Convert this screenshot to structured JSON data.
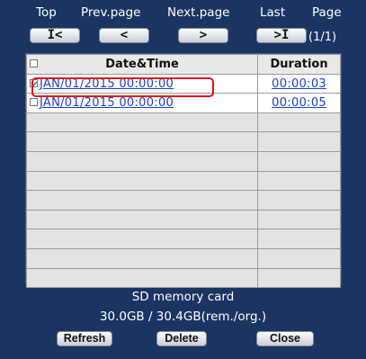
{
  "nav": {
    "top_label": "Top",
    "prev_label": "Prev.page",
    "next_label": "Next.page",
    "last_label": "Last",
    "page_label": "Page",
    "top_btn": "I<",
    "prev_btn": "<",
    "next_btn": ">",
    "last_btn": ">I",
    "page_count": "(1/1)"
  },
  "table": {
    "headers": {
      "datetime": "Date&Time",
      "duration": "Duration"
    },
    "rows": [
      {
        "datetime": "JAN/01/2015 00:00:00",
        "duration": "00:00:03",
        "checked": true
      },
      {
        "datetime": "JAN/01/2015 00:00:00",
        "duration": "00:00:05",
        "checked": false
      }
    ]
  },
  "sd": {
    "title": "SD memory card",
    "capacity": "30.0GB / 30.4GB(rem./org.)"
  },
  "actions": {
    "refresh": "Refresh",
    "delete": "Delete",
    "close": "Close"
  },
  "colors": {
    "panel_bg": "#1b3462",
    "link": "#1a3fd0",
    "highlight": "#e0141e"
  }
}
